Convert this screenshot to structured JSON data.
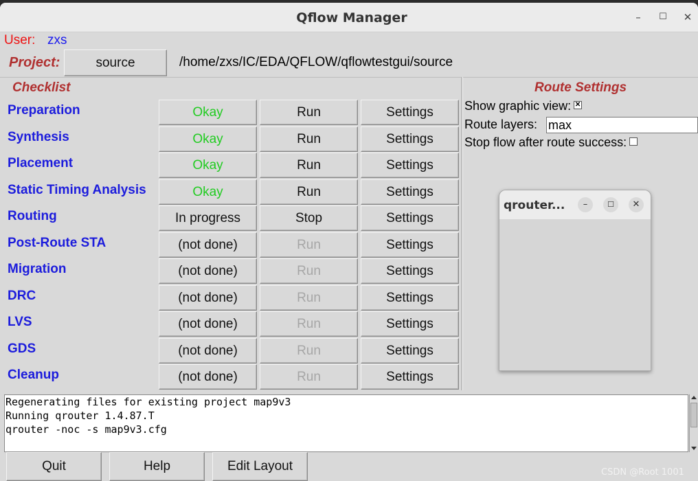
{
  "window": {
    "title": "Qflow Manager",
    "minimize": "–",
    "maximize": "☐",
    "close": "✕"
  },
  "user": {
    "label": "User:",
    "name": "zxs"
  },
  "project": {
    "label": "Project:",
    "button": "source",
    "path": "/home/zxs/IC/EDA/QFLOW/qflowtestgui/source"
  },
  "checklist": {
    "title": "Checklist",
    "steps": [
      {
        "name": "Preparation",
        "status": "Okay",
        "action": "Run",
        "settings": "Settings"
      },
      {
        "name": "Synthesis",
        "status": "Okay",
        "action": "Run",
        "settings": "Settings"
      },
      {
        "name": "Placement",
        "status": "Okay",
        "action": "Run",
        "settings": "Settings"
      },
      {
        "name": "Static Timing Analysis",
        "status": "Okay",
        "action": "Run",
        "settings": "Settings"
      },
      {
        "name": "Routing",
        "status": "In progress",
        "action": "Stop",
        "settings": "Settings"
      },
      {
        "name": "Post-Route STA",
        "status": "(not done)",
        "action": "Run",
        "settings": "Settings"
      },
      {
        "name": "Migration",
        "status": "(not done)",
        "action": "Run",
        "settings": "Settings"
      },
      {
        "name": "DRC",
        "status": "(not done)",
        "action": "Run",
        "settings": "Settings"
      },
      {
        "name": "LVS",
        "status": "(not done)",
        "action": "Run",
        "settings": "Settings"
      },
      {
        "name": "GDS",
        "status": "(not done)",
        "action": "Run",
        "settings": "Settings"
      },
      {
        "name": "Cleanup",
        "status": "(not done)",
        "action": "Run",
        "settings": "Settings"
      }
    ]
  },
  "route_settings": {
    "title": "Route Settings",
    "show_graphic_label": "Show graphic view:",
    "show_graphic_checked": true,
    "route_layers_label": "Route layers:",
    "route_layers_value": "max",
    "stop_flow_label": "Stop flow after route success:",
    "stop_flow_checked": false
  },
  "popup": {
    "title": "qrouter...",
    "minimize": "–",
    "maximize": "☐",
    "close": "✕"
  },
  "log": [
    "Regenerating files for existing project map9v3",
    "Running qrouter 1.4.87.T",
    "qrouter -noc  -s map9v3.cfg"
  ],
  "footer": {
    "quit": "Quit",
    "help": "Help",
    "edit_layout": "Edit Layout"
  },
  "watermark": "CSDN @Root 1001",
  "colors": {
    "okay": "#22cc22",
    "step_name": "#1c1cdc",
    "section_title": "#b03030",
    "disabled": "#a6a6a6"
  }
}
